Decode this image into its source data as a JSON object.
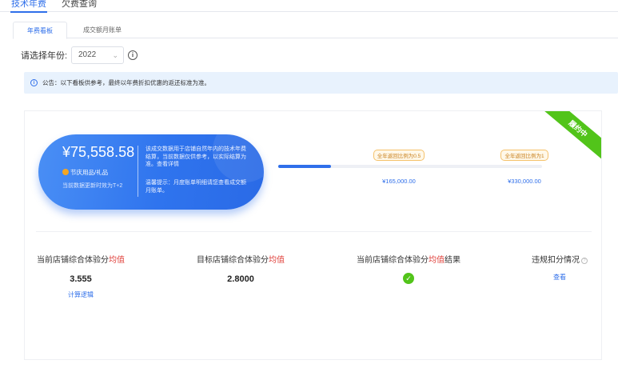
{
  "top_tabs": [
    {
      "label": "技术年费",
      "active": true
    },
    {
      "label": "欠费查询",
      "active": false
    }
  ],
  "sub_tabs": [
    {
      "label": "年费看板",
      "active": true
    },
    {
      "label": "成交额月账单",
      "active": false
    }
  ],
  "year": {
    "label": "请选择年份:",
    "value": "2022"
  },
  "notice": {
    "text": "公告：以下看板供参考，最终以年费折扣优惠的返还标准为准。"
  },
  "summary": {
    "amount": "¥75,558.58",
    "tag": "节庆用品/礼品",
    "update": "当前数据更新时效为T+2",
    "desc": "该成交数据用于店铺自然年内的技术年费结算，当前数据仅供参考，以实际结算为准。查看详情",
    "tip": "温馨提示：月度账单明细请您查看成交额月账单。"
  },
  "progress": {
    "filled_ratio": 0.2,
    "milestones": [
      {
        "badge": "全年返回比例为0.5",
        "amount": "¥165,000.00"
      },
      {
        "badge": "全年返回比例为1",
        "amount": "¥330,000.00"
      }
    ]
  },
  "status_ribbon": "履约中",
  "stats": [
    {
      "label_pre": "当前店铺综合体验分",
      "label_hl": "均值",
      "label_post": "",
      "value": "3.555",
      "link": "计算逻辑"
    },
    {
      "label_pre": "目标店铺综合体验分",
      "label_hl": "均值",
      "label_post": "",
      "value": "2.8000",
      "link": ""
    },
    {
      "label_pre": "当前店铺综合体验分",
      "label_hl": "均值",
      "label_post": "结果",
      "value": "",
      "link": ""
    },
    {
      "label_pre": "违规扣分情况",
      "label_hl": "",
      "label_post": "",
      "value": "",
      "link": "查看"
    }
  ],
  "colors": {
    "accent": "#2f6fea",
    "success": "#52c41a",
    "highlight": "#e0403b"
  }
}
